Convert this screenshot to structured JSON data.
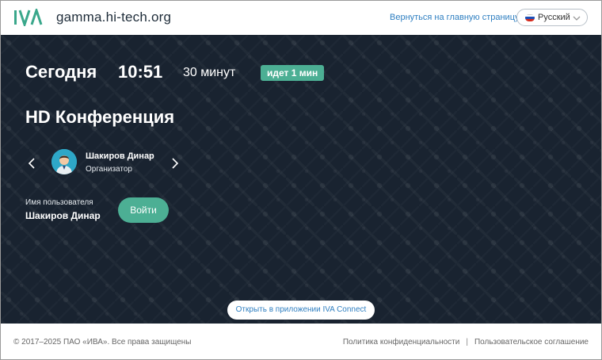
{
  "header": {
    "site": "gamma.hi-tech.org",
    "home_link": "Вернуться на главную страницу",
    "language": "Русский"
  },
  "meeting": {
    "day": "Сегодня",
    "time": "10:51",
    "duration": "30 минут",
    "status": "идет 1 мин",
    "title": "HD Конференция"
  },
  "organizer": {
    "name": "Шакиров Динар",
    "role": "Организатор"
  },
  "user": {
    "label": "Имя пользователя",
    "name": "Шакиров Динар"
  },
  "buttons": {
    "login": "Войти",
    "open_app": "Открыть в приложении IVA Connect"
  },
  "footer": {
    "copyright": "© 2017–2025 ПАО «ИВА». Все права защищены",
    "privacy": "Политика конфиденциальности",
    "separator": "|",
    "terms": "Пользовательское соглашение"
  },
  "colors": {
    "accent_green": "#4caf94",
    "link_blue": "#2f7fc1",
    "hero_bg": "#192330"
  }
}
